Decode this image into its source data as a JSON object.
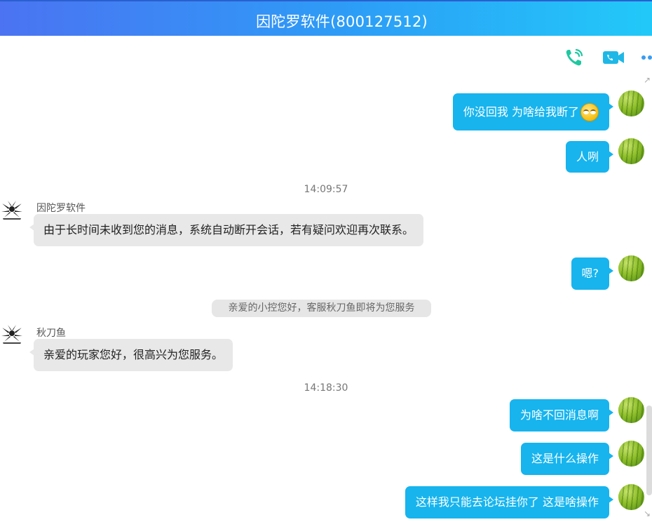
{
  "header": {
    "title": "因陀罗软件(800127512)",
    "accent_start": "#4b73f2",
    "accent_end": "#22c9f8"
  },
  "toolbar": {
    "voice_call_icon": "phone-icon",
    "video_call_icon": "video-camera-icon",
    "more_icon": "more-dots-icon",
    "icon_color": "#1fc8a0"
  },
  "messages": [
    {
      "type": "outgoing",
      "text": "你没回我 为啥给我断了",
      "has_emoji": true
    },
    {
      "type": "outgoing",
      "text": "人咧"
    },
    {
      "type": "time",
      "text": "14:09:57"
    },
    {
      "type": "incoming",
      "sender": "因陀罗软件",
      "text": "由于长时间未收到您的消息，系统自动断开会话，若有疑问欢迎再次联系。"
    },
    {
      "type": "outgoing",
      "text": "嗯?"
    },
    {
      "type": "system",
      "text": "亲爱的小控您好，客服秋刀鱼即将为您服务"
    },
    {
      "type": "incoming",
      "sender": "秋刀鱼",
      "text": "亲爱的玩家您好，很高兴为您服务。"
    },
    {
      "type": "time",
      "text": "14:18:30"
    },
    {
      "type": "outgoing",
      "text": "为啥不回消息啊"
    },
    {
      "type": "outgoing",
      "text": "这是什么操作"
    },
    {
      "type": "outgoing",
      "text": "这样我只能去论坛挂你了 这是啥操作"
    }
  ],
  "colors": {
    "outgoing_bubble": "#17b4ee",
    "incoming_bubble": "#e8e8e8",
    "system_note": "#e6e6e6"
  }
}
